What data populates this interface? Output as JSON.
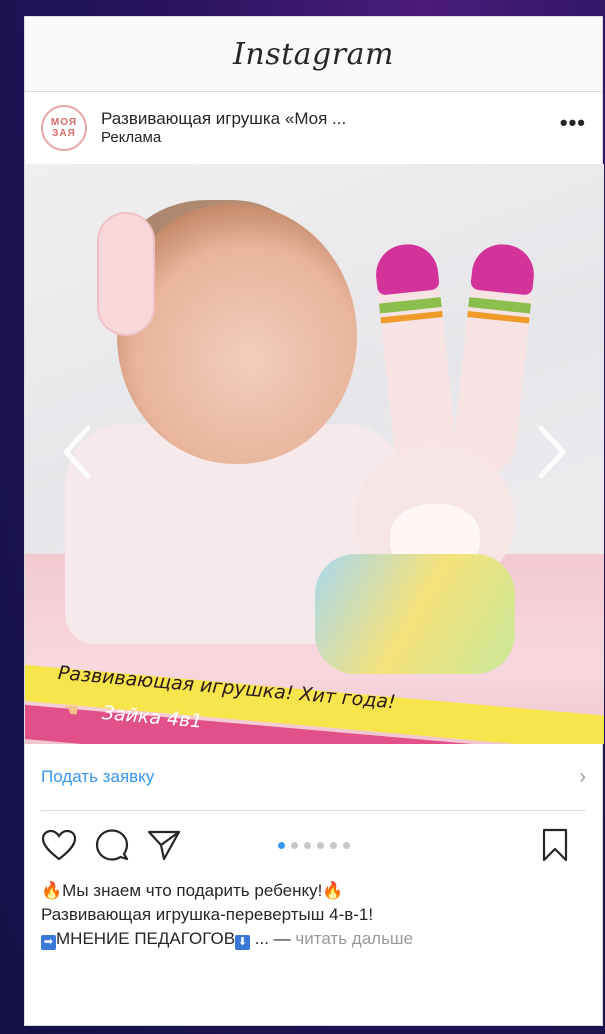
{
  "app": {
    "logo": "Instagram"
  },
  "post": {
    "avatar": {
      "line1": "МОЯ",
      "line2": "ЗАЯ"
    },
    "account_name": "Развивающая игрушка «Моя ...",
    "sponsored_label": "Реклама",
    "more_label": "•••"
  },
  "media": {
    "banner_line1": "Развивающая игрушка! Хит года!",
    "banner_line2": "Зайка 4в1",
    "carousel_index": 1,
    "carousel_total": 6
  },
  "cta": {
    "label": "Подать заявку",
    "chevron": "›"
  },
  "actions": {
    "icons": [
      "heart-icon",
      "comment-icon",
      "share-icon",
      "bookmark-icon"
    ]
  },
  "caption": {
    "line1_emoji_start": "🔥",
    "line1_text": "Мы знаем что подарить ребенку!",
    "line1_emoji_end": "🔥",
    "line2": "Развивающая игрушка-перевертыш 4-в-1!",
    "line3_arrow": "➡",
    "line3_text": "МНЕНИЕ ПЕДАГОГОВ",
    "line3_down": "⬇",
    "line3_ellipsis": "... — ",
    "read_more": "читать дальше"
  },
  "colors": {
    "link": "#3897f0",
    "dot_active": "#3897f0",
    "dot_inactive": "#c8c8c8"
  }
}
